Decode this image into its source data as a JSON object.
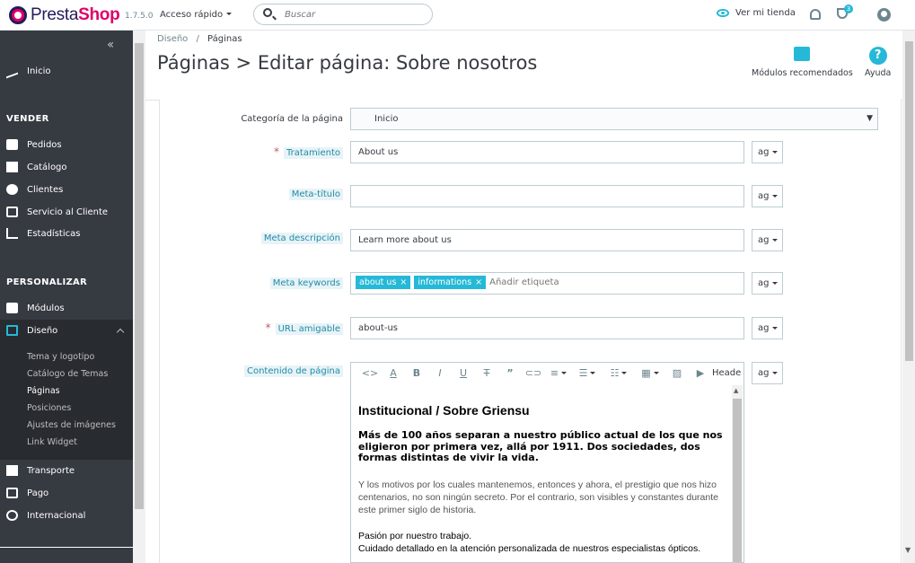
{
  "topbar": {
    "brand_pre": "Presta",
    "brand_post": "Shop",
    "version": "1.7.5.0",
    "quick_access": "Acceso rápido",
    "search_placeholder": "Buscar",
    "view_store": "Ver mi tienda",
    "notifications_count": "3"
  },
  "sidebar": {
    "home": "Inicio",
    "sell_section": "VENDER",
    "orders": "Pedidos",
    "catalog": "Catálogo",
    "customers": "Clientes",
    "customer_service": "Servicio al Cliente",
    "stats": "Estadísticas",
    "customize_section": "PERSONALIZAR",
    "modules": "Módulos",
    "design": "Diseño",
    "design_sub": [
      "Tema y logotipo",
      "Catálogo de Temas",
      "Páginas",
      "Posiciones",
      "Ajustes de imágenes",
      "Link Widget"
    ],
    "shipping": "Transporte",
    "payment": "Pago",
    "international": "Internacional"
  },
  "header": {
    "breadcrumb_parent": "Diseño",
    "breadcrumb_sep": "/",
    "breadcrumb_current": "Páginas",
    "title": "Páginas > Editar página: Sobre nosotros",
    "recommended_modules": "Módulos recomendados",
    "help": "Ayuda"
  },
  "form": {
    "category_label": "Categoría de la página",
    "category_value": "Inicio",
    "title_label": "Tratamiento",
    "title_value": "About us",
    "meta_title_label": "Meta-título",
    "meta_title_value": "",
    "meta_desc_label": "Meta descripción",
    "meta_desc_value": "Learn more about us",
    "keywords_label": "Meta keywords",
    "keywords": [
      "about us",
      "informations"
    ],
    "add_tag_placeholder": "Añadir etiqueta",
    "url_label": "URL amigable",
    "url_value": "about-us",
    "content_label": "Contenido de página",
    "lang": "ag",
    "required_mark": "*"
  },
  "editor": {
    "format_label": "Heade",
    "heading": "Institucional / Sobre Griensu",
    "lead": "Más de 100 años separan a nuestro público actual de los que nos eligieron por primera vez, allá por 1911. Dos sociedades, dos formas distintas de vivir la vida.",
    "paragraph": "Y los motivos por los cuales mantenemos, entonces y ahora, el prestigio que nos hizo centenarios, no son ningún secreto. Por el contrario, son visibles y constantes durante este primer siglo de historia.",
    "line1": "Pasión por nuestro trabajo.",
    "line2": "Cuidado detallado en la atención personalizada de nuestros especialistas ópticos."
  },
  "colors": {
    "accent": "#25b9d7",
    "sidebar": "#363a41",
    "brand": "#df0067"
  }
}
